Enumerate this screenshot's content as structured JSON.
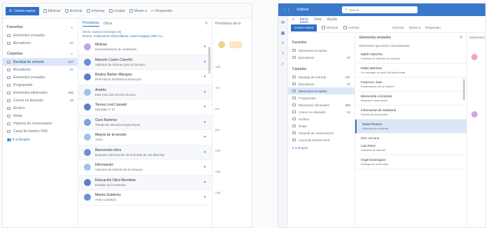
{
  "left": {
    "ribbon": {
      "new_label": "Correo nuevo",
      "items": [
        "Eliminar",
        "Archivar",
        "Informar",
        "Limpiar",
        "Mover a",
        "Responder"
      ]
    },
    "folders": {
      "favorites_header": "Favoritos",
      "favorites": [
        {
          "label": "Elementos enviados",
          "count": ""
        },
        {
          "label": "Borradores",
          "count": "27"
        }
      ],
      "account_header": "Carpetas",
      "items": [
        {
          "label": "Bandeja de entrada",
          "count": "187",
          "selected": true
        },
        {
          "label": "Borradores",
          "count": "27"
        },
        {
          "label": "Elementos enviados",
          "count": ""
        },
        {
          "label": "Programado",
          "count": ""
        },
        {
          "label": "Elementos eliminados",
          "count": "306"
        },
        {
          "label": "Correo no deseado",
          "count": "44"
        },
        {
          "label": "Archivo",
          "count": ""
        },
        {
          "label": "Notas",
          "count": ""
        },
        {
          "label": "Historial de conversación",
          "count": ""
        },
        {
          "label": "Canal de fuentes RSS",
          "count": ""
        }
      ],
      "groups_link": "Ir a Grupos"
    },
    "list": {
      "tab_focused": "Prioritarios",
      "tab_other": "Otros",
      "banner_line1": "Otros: nuevos mensajes (4)",
      "banner_line2": "Denon, Invitaciones Informáticas, Lead Imaging Chile Co...",
      "messages": [
        {
          "from": "Melissa",
          "subject": "Documentación de certificado",
          "color": "#b7a8e6"
        },
        {
          "from": "Marcelo Castro Carreño",
          "subject": "Solicitud de informe para el Servicio",
          "color": "#6c8fd8"
        },
        {
          "from": "Beatriz Barber Márquez",
          "subject": "PARTIDOS INTERNACIONALES",
          "color": "#5a7fc9"
        },
        {
          "from": "Andrés",
          "subject": "Este mes del servicio técnico",
          "color": "#9cc3ea"
        },
        {
          "from": "Teresa Leal Cassani",
          "subject": "Mensaje nº 27",
          "color": "#5a7fc9"
        },
        {
          "from": "Ouro Ramírez",
          "subject": "Tienda de artículos Ropa Reyna",
          "color": "#7e9fd9"
        },
        {
          "from": "Mejora de la versión",
          "subject": "Aviso",
          "color": "#9cc3ea"
        },
        {
          "from": "Bienvenida mitra",
          "subject": "Requiere información de la tienda de sus librerías",
          "color": "#6c8fd8"
        },
        {
          "from": "Información",
          "subject": "Solicitud de informe de la semana",
          "color": "#9cc3ea"
        },
        {
          "from": "Educación Obra Mendieta",
          "subject": "Entrada de la semana",
          "color": "#5a7fc9"
        },
        {
          "from": "Marisa Gutiérrez",
          "subject": "Aviso Contacto",
          "color": "#6c8fd8"
        }
      ]
    },
    "reading": {
      "header": "Prioritarios de la",
      "dates": [
        "sáb",
        "vie",
        "jue",
        "jue",
        "mié",
        "mié",
        "mar"
      ]
    }
  },
  "right": {
    "brand": "Outlook",
    "search_placeholder": "Buscar",
    "tabs": [
      "Inicio",
      "Vista",
      "Ayuda"
    ],
    "ribbon": {
      "new_label": "Correo nuevo",
      "items": [
        "Eliminar",
        "Archivar",
        "Informar",
        "Mover a",
        "Responder"
      ]
    },
    "folders": {
      "favorites_header": "Favoritos",
      "favorites": [
        {
          "label": "Elementos enviados",
          "count": ""
        },
        {
          "label": "Borradores",
          "count": "27"
        }
      ],
      "account_header": "Carpetas",
      "items": [
        {
          "label": "Bandeja de entrada",
          "count": "187"
        },
        {
          "label": "Borradores",
          "count": "27"
        },
        {
          "label": "Elementos enviados",
          "count": "",
          "selected": true
        },
        {
          "label": "Programado",
          "count": ""
        },
        {
          "label": "Elementos eliminados",
          "count": "306"
        },
        {
          "label": "Correo no deseado",
          "count": "44"
        },
        {
          "label": "Archivo",
          "count": ""
        },
        {
          "label": "Notas",
          "count": ""
        },
        {
          "label": "Historial de conversación",
          "count": ""
        },
        {
          "label": "Canal de fuentes RSS",
          "count": ""
        }
      ],
      "groups_link": "Ir a Grupos"
    },
    "list": {
      "header": "Elementos enviados",
      "info": "Elementos que envió correctamente",
      "messages": [
        {
          "from": "Martín Sánchez",
          "date": "",
          "subject": "Solicitud de informe del servicio"
        },
        {
          "from": "Pablo Martínez",
          "date": "",
          "subject": "Un mensaje de texto de Bienvenida"
        },
        {
          "from": "Francisco Juan",
          "date": "",
          "subject": "Presentación de la reunión"
        },
        {
          "from": "Bienvenida a la tienda",
          "date": "",
          "subject": "Requiere información"
        },
        {
          "from": "Información de Sabiduría",
          "date": "",
          "subject": "Horario de la semana"
        },
        {
          "from": "Daniel Ramos",
          "date": "",
          "subject": "Solicitud de la tienda",
          "selected": true
        }
      ],
      "group_label": "Este semana",
      "messages2": [
        {
          "from": "Luis Pérez",
          "date": "",
          "subject": "Solicitud de informe"
        },
        {
          "from": "Ángel Domínguez",
          "date": "",
          "subject": "Entrega de la semana"
        }
      ]
    },
    "reading": {
      "header": "Soluciones"
    }
  }
}
